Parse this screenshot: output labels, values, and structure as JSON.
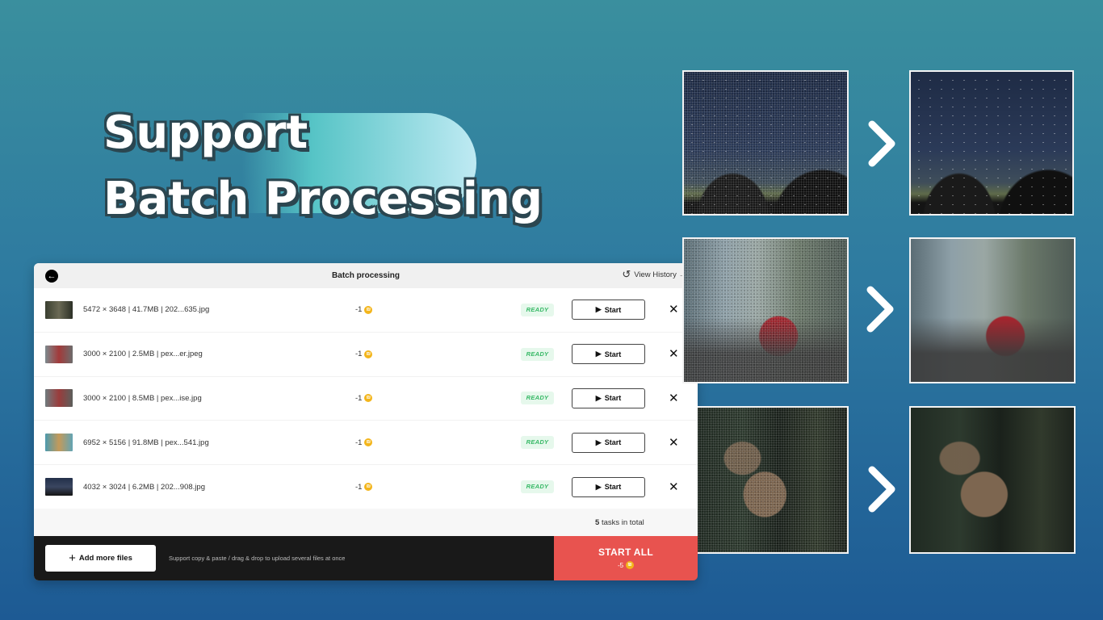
{
  "headline": {
    "line1": "Support",
    "line2": "Batch Processing"
  },
  "panel": {
    "title": "Batch processing",
    "view_history": "View History →",
    "rows": [
      {
        "info": "5472 × 3648 | 41.7MB | 202...635.jpg",
        "cost": "-1",
        "status": "READY",
        "start": "Start",
        "thumb": "#4a5040"
      },
      {
        "info": "3000 × 2100 | 2.5MB | pex...er.jpeg",
        "cost": "-1",
        "status": "READY",
        "start": "Start",
        "thumb": "#8a7a70"
      },
      {
        "info": "3000 × 2100 | 8.5MB | pex...ise.jpg",
        "cost": "-1",
        "status": "READY",
        "start": "Start",
        "thumb": "#7b7a78"
      },
      {
        "info": "6952 × 5156 | 91.8MB | pex...541.jpg",
        "cost": "-1",
        "status": "READY",
        "start": "Start",
        "thumb": "#5a9aa8"
      },
      {
        "info": "4032 × 3024 | 6.2MB | 202...908.jpg",
        "cost": "-1",
        "status": "READY",
        "start": "Start",
        "thumb": "#2a3448"
      }
    ],
    "total_count": "5",
    "total_suffix": "tasks in total",
    "add_more": "Add more files",
    "hint": "Support copy & paste / drag & drop to upload several files at once",
    "start_all": "START ALL",
    "start_all_cost": "-5"
  },
  "colors": {
    "ready_text": "#36b865",
    "start_all_bg": "#e8534f",
    "coin": "#f3b51b"
  }
}
